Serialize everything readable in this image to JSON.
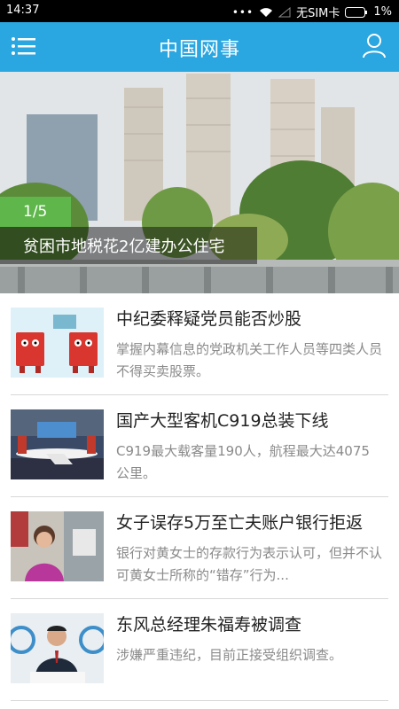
{
  "status_bar": {
    "time": "14:37",
    "dots": "•••",
    "carrier": "无SIM卡",
    "battery": "1%"
  },
  "header": {
    "title": "中国网事",
    "menu_icon": "menu-icon",
    "user_icon": "user-icon",
    "background_color": "#2aa6e0"
  },
  "hero": {
    "counter": "1/5",
    "caption": "贫困市地税花2亿建办公住宅"
  },
  "news": [
    {
      "title": "中纪委释疑党员能否炒股",
      "summary": "掌握内幕信息的党政机关工作人员等四类人员不得买卖股票。"
    },
    {
      "title": "国产大型客机C919总装下线",
      "summary": "C919最大载客量190人，航程最大达4075公里。"
    },
    {
      "title": "女子误存5万至亡夫账户银行拒返",
      "summary": "银行对黄女士的存款行为表示认可，但并不认可黄女士所称的“错存”行为..."
    },
    {
      "title": "东风总经理朱福寿被调查",
      "summary": "涉嫌严重违纪，目前正接受组织调查。"
    }
  ]
}
